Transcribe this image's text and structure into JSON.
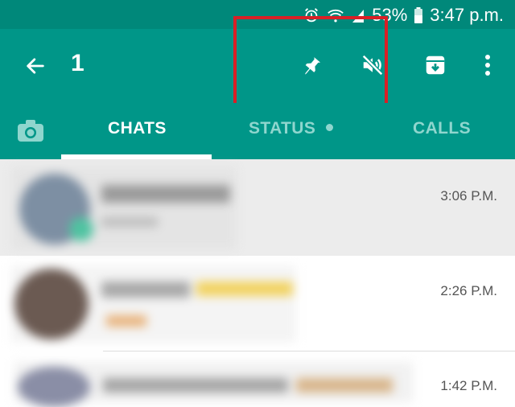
{
  "status_bar": {
    "battery": "53%",
    "time": "3:47 p.m."
  },
  "selection_bar": {
    "selected_count": "1",
    "actions": [
      "back-icon",
      "pin-icon",
      "mute-icon",
      "archive-icon",
      "more-options-icon"
    ]
  },
  "tabs": [
    {
      "label": "CHATS",
      "active": true
    },
    {
      "label": "STATUS",
      "active": false,
      "has_dot": true
    },
    {
      "label": "CALLS",
      "active": false
    }
  ],
  "chats": [
    {
      "time": "3:06 P.M.",
      "selected": true
    },
    {
      "time": "2:26 P.M.",
      "selected": false
    },
    {
      "time": "1:42 P.M.",
      "selected": false
    }
  ],
  "colors": {
    "toolbar": "#009688",
    "statusbar": "#00887a",
    "inactive_tab": "#8fd6ce",
    "highlight": "#d91f26"
  }
}
